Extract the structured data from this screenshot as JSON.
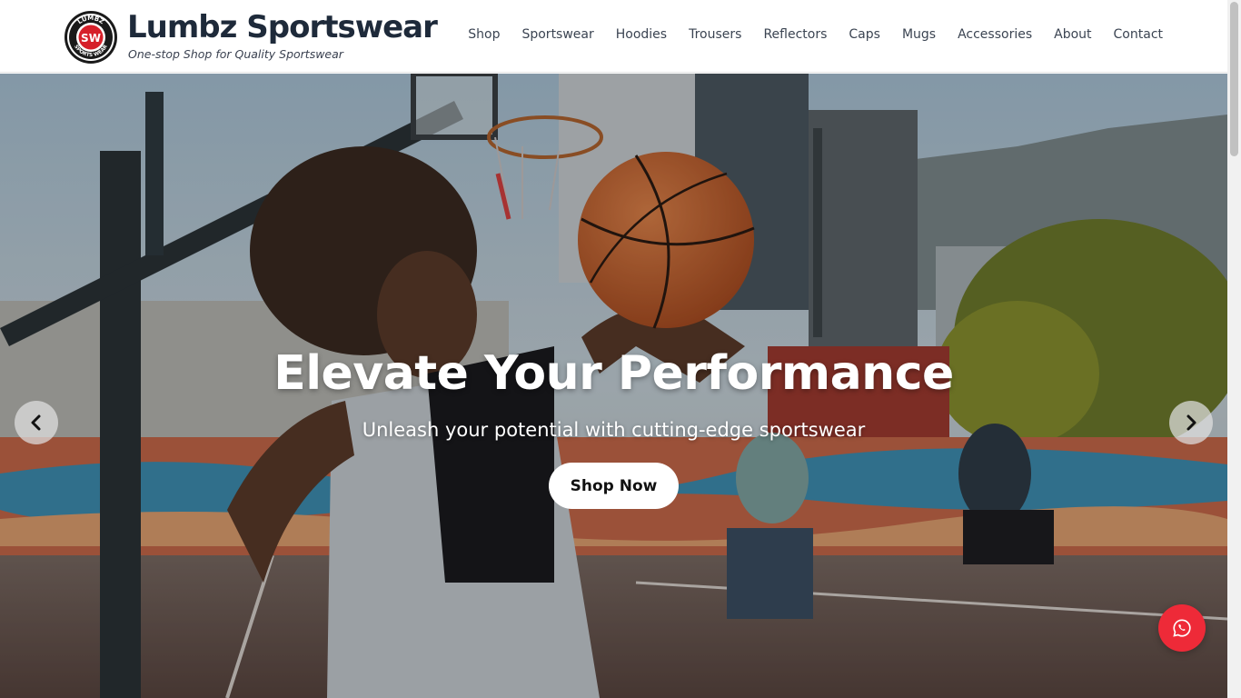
{
  "brand": {
    "name": "Lumbz Sportswear",
    "tagline": "One-stop Shop for Quality Sportswear",
    "badge_top": "LUMBZ",
    "badge_bottom": "SPORTS WEAR",
    "badge_mono": "SW",
    "colors": {
      "badge_red": "#d6202a",
      "badge_dark": "#1a1a1a",
      "text": "#1e2a3a"
    }
  },
  "nav": {
    "items": [
      {
        "label": "Shop"
      },
      {
        "label": "Sportswear"
      },
      {
        "label": "Hoodies"
      },
      {
        "label": "Trousers"
      },
      {
        "label": "Reflectors"
      },
      {
        "label": "Caps"
      },
      {
        "label": "Mugs"
      },
      {
        "label": "Accessories"
      },
      {
        "label": "About"
      },
      {
        "label": "Contact"
      }
    ]
  },
  "hero": {
    "title": "Elevate Your Performance",
    "subtitle": "Unleash your potential with cutting-edge sportswear",
    "cta_label": "Shop Now",
    "prev_icon": "chevron-left-icon",
    "next_icon": "chevron-right-icon"
  },
  "floating": {
    "whatsapp_icon": "whatsapp-icon",
    "whatsapp_color": "#ee2a38"
  }
}
